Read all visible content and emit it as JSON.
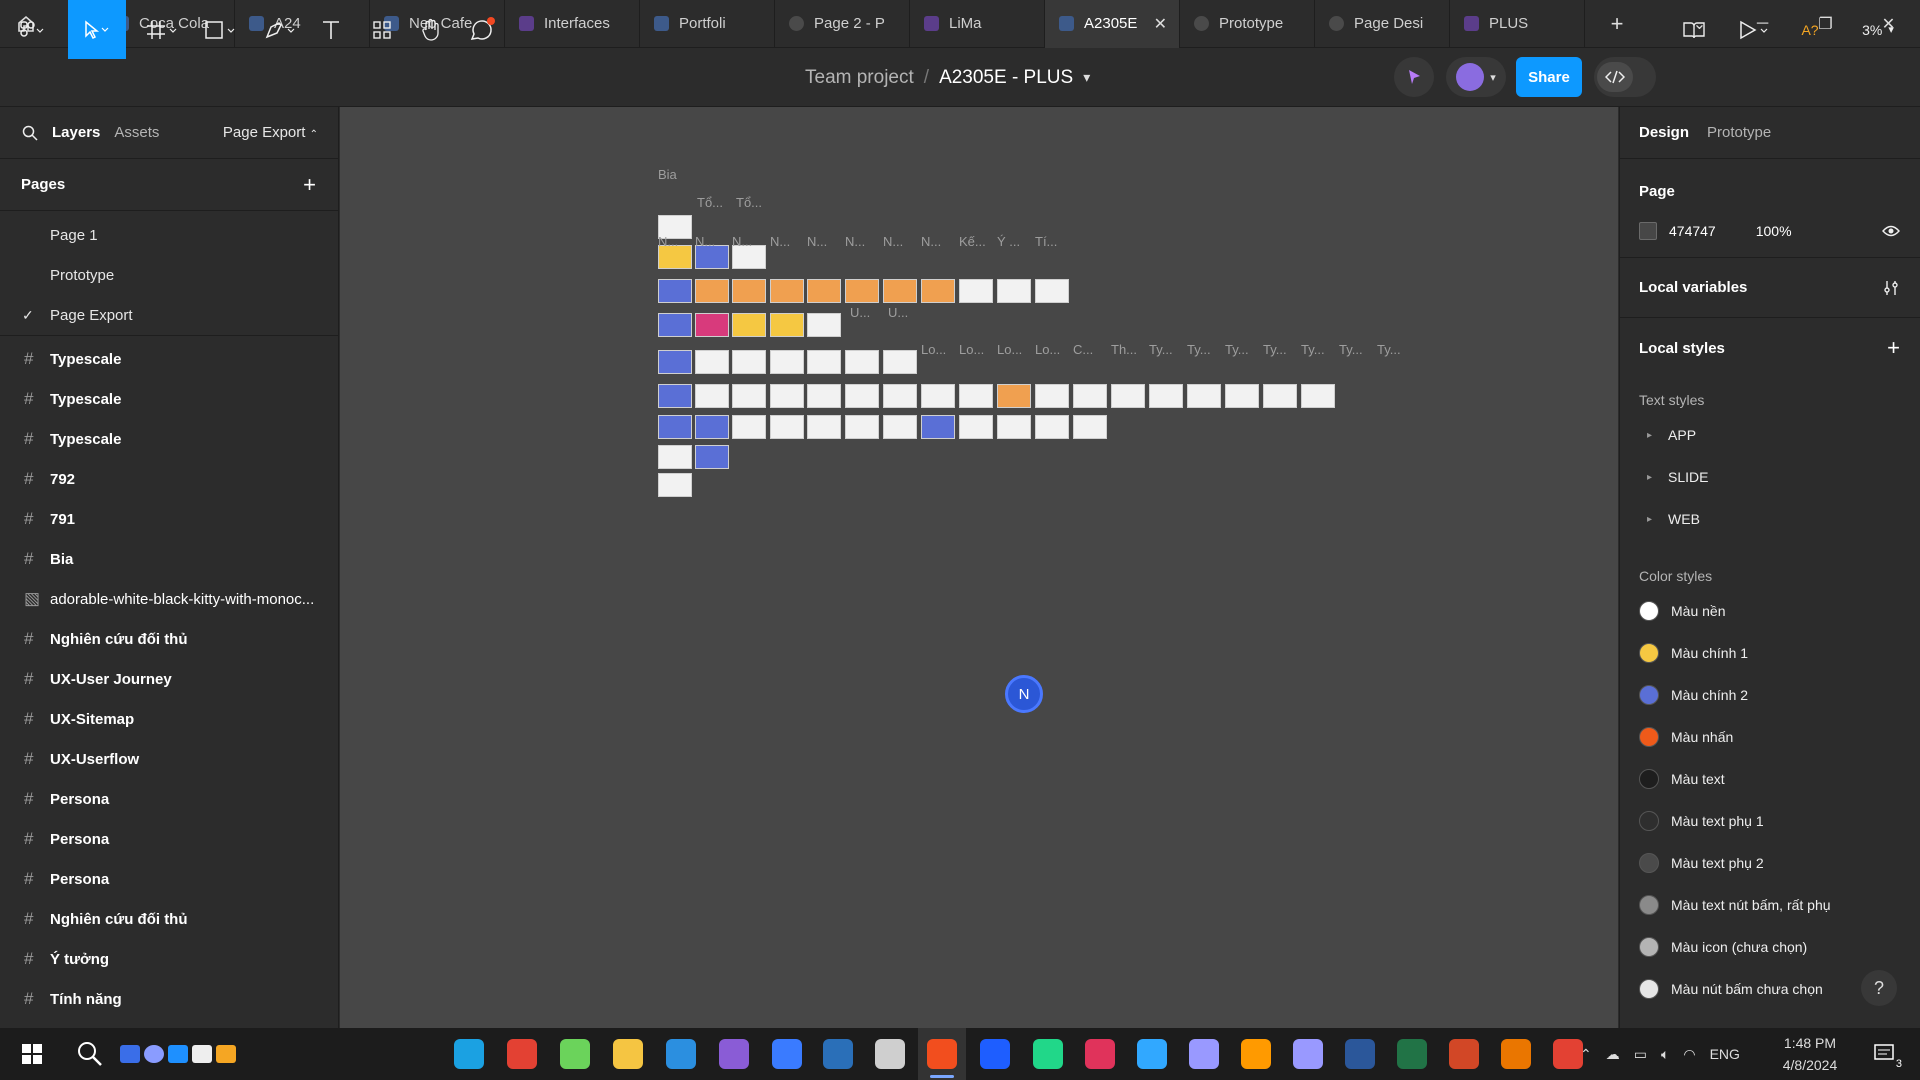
{
  "tabs": [
    {
      "label": "Coca Cola",
      "kind": "f"
    },
    {
      "label": "A24",
      "kind": "f"
    },
    {
      "label": "Neo Cafe",
      "kind": "f"
    },
    {
      "label": "Interfaces",
      "kind": "p"
    },
    {
      "label": "Portfoli",
      "kind": "f"
    },
    {
      "label": "Page 2 - P",
      "kind": "play"
    },
    {
      "label": "LiMa",
      "kind": "p"
    },
    {
      "label": "A2305E",
      "kind": "f",
      "active": true
    },
    {
      "label": "Prototype",
      "kind": "play"
    },
    {
      "label": "Page Desi",
      "kind": "play"
    },
    {
      "label": "PLUS",
      "kind": "p"
    }
  ],
  "toolbar": {
    "team": "Team project",
    "sep": "/",
    "file": "A2305E - PLUS",
    "share": "Share",
    "font_check": "A?",
    "zoom": "3%"
  },
  "left_panel": {
    "tab_layers": "Layers",
    "tab_assets": "Assets",
    "page_export": "Page Export",
    "pages_header": "Pages",
    "pages": [
      "Page 1",
      "Prototype",
      "Page Export"
    ],
    "layers": [
      "Typescale",
      "Typescale",
      "Typescale",
      "792",
      "791",
      "Bia",
      "adorable-white-black-kitty-with-monoc...",
      "Nghiên cứu đối thủ",
      "UX-User Journey",
      "UX-Sitemap",
      "UX-Userflow",
      "Persona",
      "Persona",
      "Persona",
      "Nghiên cứu đối thủ",
      "Ý tưởng",
      "Tính năng"
    ]
  },
  "canvas": {
    "labels": [
      "Bia",
      "Tổ...",
      "Tổ...",
      "N...",
      "N...",
      "N...",
      "N...",
      "N...",
      "N...",
      "N...",
      "N...",
      "Kế...",
      "Ý ...",
      "Tí...",
      "U...",
      "U...",
      "Lo...",
      "Lo...",
      "Lo...",
      "Lo...",
      "C...",
      "Th...",
      "Ty...",
      "Ty...",
      "Ty...",
      "Ty...",
      "Ty...",
      "Ty...",
      "Ty..."
    ],
    "cursor": "N"
  },
  "right_panel": {
    "tab_design": "Design",
    "tab_prototype": "Prototype",
    "page_header": "Page",
    "page_color": "474747",
    "page_opacity": "100%",
    "local_variables": "Local variables",
    "local_styles": "Local styles",
    "text_styles_header": "Text styles",
    "text_styles": [
      "APP",
      "SLIDE",
      "WEB"
    ],
    "color_styles_header": "Color styles",
    "colors": [
      {
        "name": "Màu nền",
        "hex": "#ffffff"
      },
      {
        "name": "Màu chính 1",
        "hex": "#f5c842"
      },
      {
        "name": "Màu chính 2",
        "hex": "#5a6fd6"
      },
      {
        "name": "Màu nhấn",
        "hex": "#ef5a1a"
      },
      {
        "name": "Màu text",
        "hex": "#1e1e1e"
      },
      {
        "name": "Màu text phụ 1",
        "hex": "#2e2e2e"
      },
      {
        "name": "Màu text phụ 2",
        "hex": "#4a4a4a"
      },
      {
        "name": "Màu text nút bấm, rất phụ",
        "hex": "#8a8a8a"
      },
      {
        "name": "Màu icon (chưa chọn)",
        "hex": "#b4b4b4"
      },
      {
        "name": "Màu nút bấm chưa chọn",
        "hex": "#e6e6e6"
      }
    ],
    "help": "?"
  },
  "taskbar": {
    "lang": "ENG",
    "time": "1:48 PM",
    "date": "4/8/2024",
    "notif": "3"
  }
}
